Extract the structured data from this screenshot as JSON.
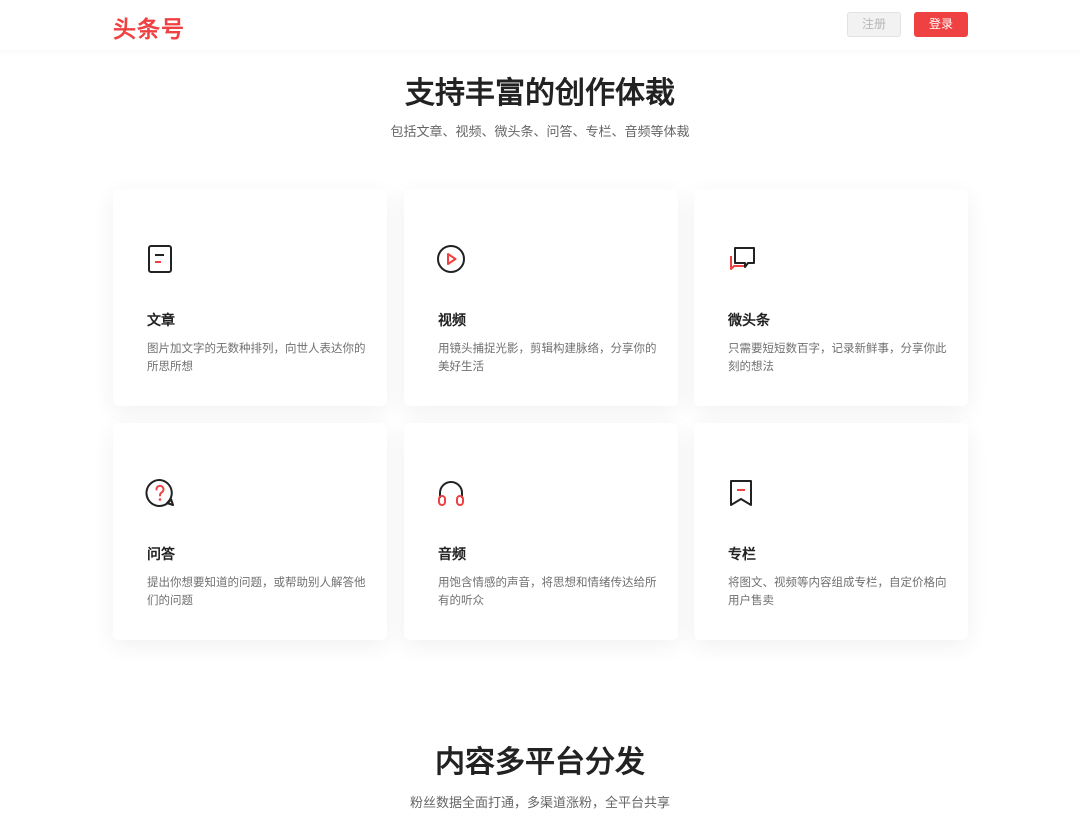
{
  "header": {
    "logo": "头条号",
    "register_label": "注册",
    "login_label": "登录"
  },
  "section1": {
    "title": "支持丰富的创作体裁",
    "subtitle": "包括文章、视频、微头条、问答、专栏、音频等体裁"
  },
  "cards": [
    {
      "title": "文章",
      "desc": "图片加文字的无数种排列，向世人表达你的所思所想",
      "icon": "article-icon"
    },
    {
      "title": "视频",
      "desc": "用镜头捕捉光影，剪辑构建脉络，分享你的美好生活",
      "icon": "play-icon"
    },
    {
      "title": "微头条",
      "desc": "只需要短短数百字，记录新鲜事，分享你此刻的想法",
      "icon": "chat-bubbles-icon"
    },
    {
      "title": "问答",
      "desc": "提出你想要知道的问题，或帮助别人解答他们的问题",
      "icon": "question-icon"
    },
    {
      "title": "音频",
      "desc": "用饱含情感的声音，将思想和情绪传达给所有的听众",
      "icon": "headphones-icon"
    },
    {
      "title": "专栏",
      "desc": "将图文、视频等内容组成专栏，自定价格向用户售卖",
      "icon": "bookmark-icon"
    }
  ],
  "section2": {
    "title": "内容多平台分发",
    "subtitle": "粉丝数据全面打通，多渠道涨粉，全平台共享"
  },
  "colors": {
    "brand": "#f04142",
    "text": "#222222",
    "muted": "#707070"
  }
}
